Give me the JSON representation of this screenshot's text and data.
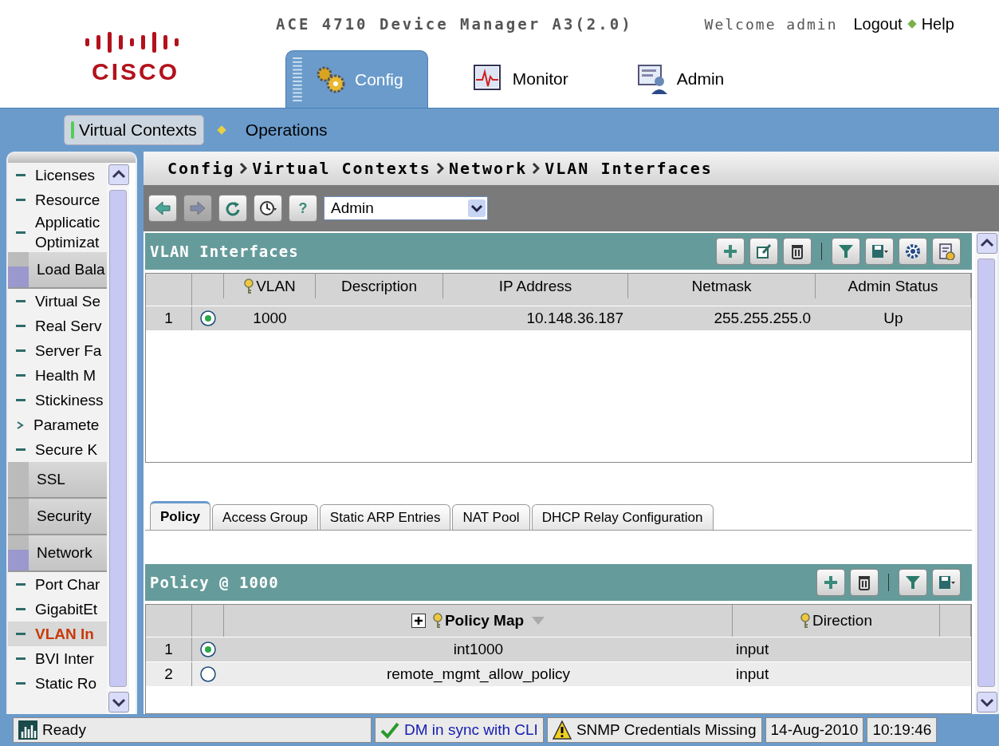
{
  "header": {
    "logo": "CISCO",
    "app_title": "ACE 4710 Device Manager A3(2.0)",
    "welcome": "Welcome admin",
    "links": [
      "Logout",
      "Help"
    ]
  },
  "main_tabs": [
    {
      "label": "Config",
      "kind": "config",
      "selected": true
    },
    {
      "label": "Monitor",
      "kind": "monitor",
      "selected": false
    },
    {
      "label": "Admin",
      "kind": "admin",
      "selected": false
    }
  ],
  "sub_nav": [
    {
      "label": "Virtual Contexts",
      "selected": true
    },
    {
      "label": "Operations",
      "selected": false
    }
  ],
  "sidebar": {
    "items": [
      {
        "label": "Licenses",
        "kind": "leaf",
        "selected": false
      },
      {
        "label": "Resource",
        "kind": "leaf",
        "selected": false
      },
      {
        "label": "Applicatic Optimizat",
        "kind": "leaf",
        "selected": false
      },
      {
        "label": "Load Bala",
        "kind": "section",
        "expanded": true
      },
      {
        "label": "Virtual Se",
        "kind": "leaf",
        "selected": false
      },
      {
        "label": "Real Serv",
        "kind": "leaf",
        "selected": false
      },
      {
        "label": "Server Fa",
        "kind": "leaf",
        "selected": false
      },
      {
        "label": "Health M",
        "kind": "leaf",
        "selected": false
      },
      {
        "label": "Stickiness",
        "kind": "leaf",
        "selected": false
      },
      {
        "label": "Paramete",
        "kind": "branch",
        "selected": false
      },
      {
        "label": "Secure K",
        "kind": "leaf",
        "selected": false
      },
      {
        "label": "SSL",
        "kind": "section",
        "expanded": false
      },
      {
        "label": "Security",
        "kind": "section",
        "expanded": false
      },
      {
        "label": "Network",
        "kind": "section",
        "expanded": true
      },
      {
        "label": "Port Char",
        "kind": "leaf",
        "selected": false
      },
      {
        "label": "GigabitEt",
        "kind": "leaf",
        "selected": false
      },
      {
        "label": "VLAN In",
        "kind": "leaf",
        "selected": true
      },
      {
        "label": "BVI Inter",
        "kind": "leaf",
        "selected": false
      },
      {
        "label": "Static Ro",
        "kind": "leaf",
        "selected": false
      }
    ]
  },
  "breadcrumb": [
    "Config",
    "Virtual Contexts",
    "Network",
    "VLAN Interfaces"
  ],
  "nav_toolbar": [
    {
      "kind": "back",
      "disabled": false
    },
    {
      "kind": "forward",
      "disabled": true
    },
    {
      "kind": "refresh",
      "disabled": false
    },
    {
      "kind": "history",
      "disabled": false
    },
    {
      "kind": "help",
      "label": "?",
      "disabled": false
    }
  ],
  "context_select": {
    "value": "Admin"
  },
  "vlan_panel": {
    "title": "VLAN Interfaces",
    "tools": [
      {
        "kind": "add"
      },
      {
        "kind": "edit"
      },
      {
        "kind": "delete"
      },
      {
        "kind": "sep"
      },
      {
        "kind": "filter"
      },
      {
        "kind": "save"
      },
      {
        "kind": "settings"
      },
      {
        "kind": "wizard"
      }
    ],
    "columns": [
      {
        "label": "VLAN",
        "key": true
      },
      {
        "label": "Description",
        "key": false
      },
      {
        "label": "IP Address",
        "key": false
      },
      {
        "label": "Netmask",
        "key": false
      },
      {
        "label": "Admin Status",
        "key": false
      }
    ],
    "rows": [
      {
        "number": "1",
        "selected": true,
        "cells": [
          "1000",
          null,
          "10.148.36.187",
          "255.255.255.0",
          "Up"
        ]
      }
    ]
  },
  "detail_tabs": [
    {
      "label": "Policy",
      "selected": true
    },
    {
      "label": "Access Group",
      "selected": false
    },
    {
      "label": "Static ARP Entries",
      "selected": false
    },
    {
      "label": "NAT Pool",
      "selected": false
    },
    {
      "label": "DHCP Relay Configuration",
      "selected": false
    }
  ],
  "policy_panel": {
    "title": "Policy @ 1000",
    "tools": [
      {
        "kind": "add"
      },
      {
        "kind": "delete"
      },
      {
        "kind": "sep"
      },
      {
        "kind": "filter"
      },
      {
        "kind": "save"
      }
    ],
    "columns": [
      {
        "label": "Policy Map",
        "key": true,
        "expand": true,
        "sorted": true
      },
      {
        "label": "Direction",
        "key": true,
        "expand": false,
        "sorted": false
      }
    ],
    "rows": [
      {
        "number": "1",
        "selected": true,
        "cells": [
          "int1000",
          "input"
        ]
      },
      {
        "number": "2",
        "selected": false,
        "cells": [
          "remote_mgmt_allow_policy",
          "input"
        ]
      }
    ]
  },
  "status_bar": [
    {
      "kind": "ready",
      "text": "Ready"
    },
    {
      "kind": "ok",
      "text": "DM in sync with CLI"
    },
    {
      "kind": "warning",
      "text": "SNMP Credentials Missing"
    },
    {
      "kind": "plain",
      "text": "14-Aug-2010"
    },
    {
      "kind": "plain",
      "text": "10:19:46"
    }
  ]
}
